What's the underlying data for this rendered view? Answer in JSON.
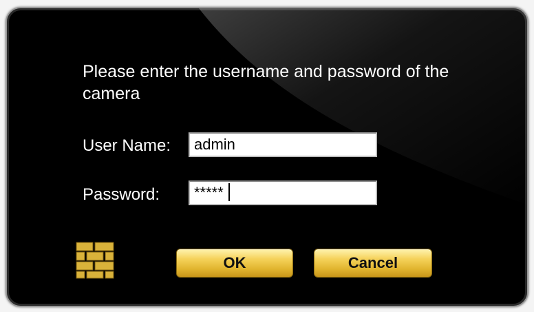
{
  "dialog": {
    "prompt": "Please enter the username and password of the camera",
    "username_label": "User Name:",
    "username_value": "admin",
    "password_label": "Password:",
    "password_masked": "*****",
    "ok_label": "OK",
    "cancel_label": "Cancel",
    "icons": {
      "firewall": "firewall-icon"
    }
  },
  "colors": {
    "background": "#000000",
    "text": "#ffffff",
    "button_gold": "#e2b630"
  }
}
